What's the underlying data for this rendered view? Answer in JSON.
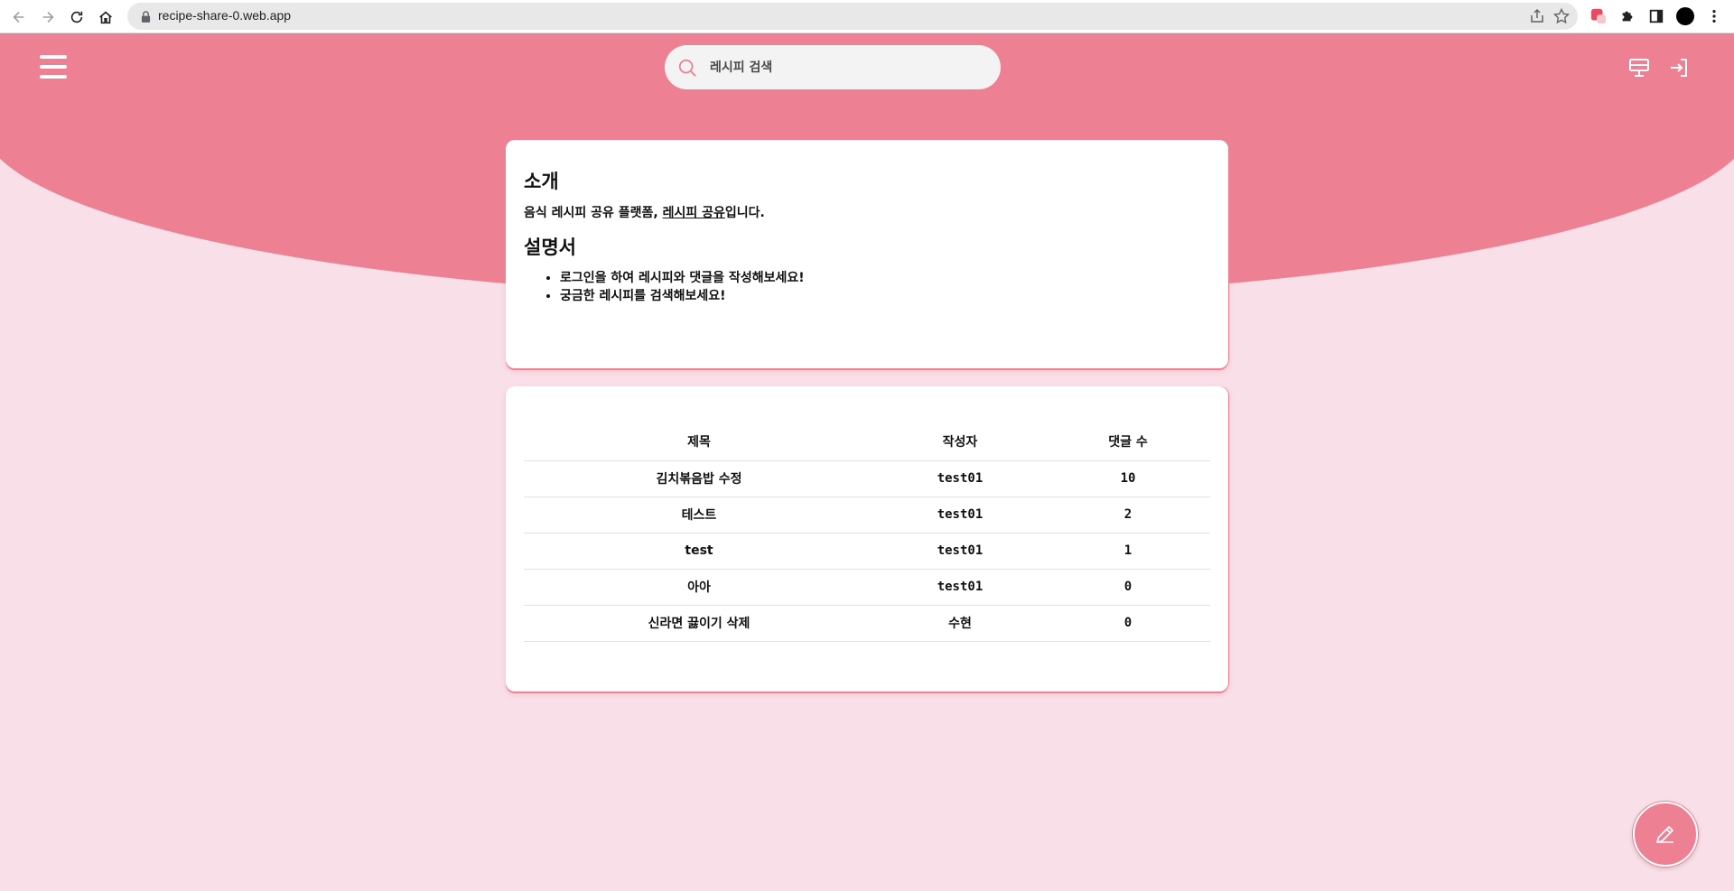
{
  "browser": {
    "url": "recipe-share-0.web.app"
  },
  "header": {
    "search": {
      "placeholder": "레시피 검색",
      "value": ""
    }
  },
  "intro": {
    "title": "소개",
    "description_prefix": "음식 레시피 공유 플랫폼, ",
    "description_link": "레시피 공유",
    "description_suffix": "입니다.",
    "manual_title": "설명서",
    "manual_items": [
      "로그인을 하여 레시피와 댓글을 작성해보세요!",
      "궁금한 레시피를 검색해보세요!"
    ]
  },
  "recipes": {
    "columns": [
      "제목",
      "작성자",
      "댓글 수"
    ],
    "rows": [
      {
        "title": "김치볶음밥 수정",
        "author": "test01",
        "comments": "10"
      },
      {
        "title": "테스트",
        "author": "test01",
        "comments": "2"
      },
      {
        "title": "test",
        "author": "test01",
        "comments": "1"
      },
      {
        "title": "아아",
        "author": "test01",
        "comments": "0"
      },
      {
        "title": "신라면 끓이기 삭제",
        "author": "수현",
        "comments": "0"
      }
    ]
  },
  "icons": {
    "menu": "hamburger-menu-icon",
    "search": "search-icon",
    "board": "board-icon",
    "login": "login-icon",
    "write": "pencil-icon"
  },
  "colors": {
    "accent": "#ee8094",
    "background": "#f9dfe7",
    "search_bg": "#f3f3f3",
    "card": "#ffffff"
  }
}
